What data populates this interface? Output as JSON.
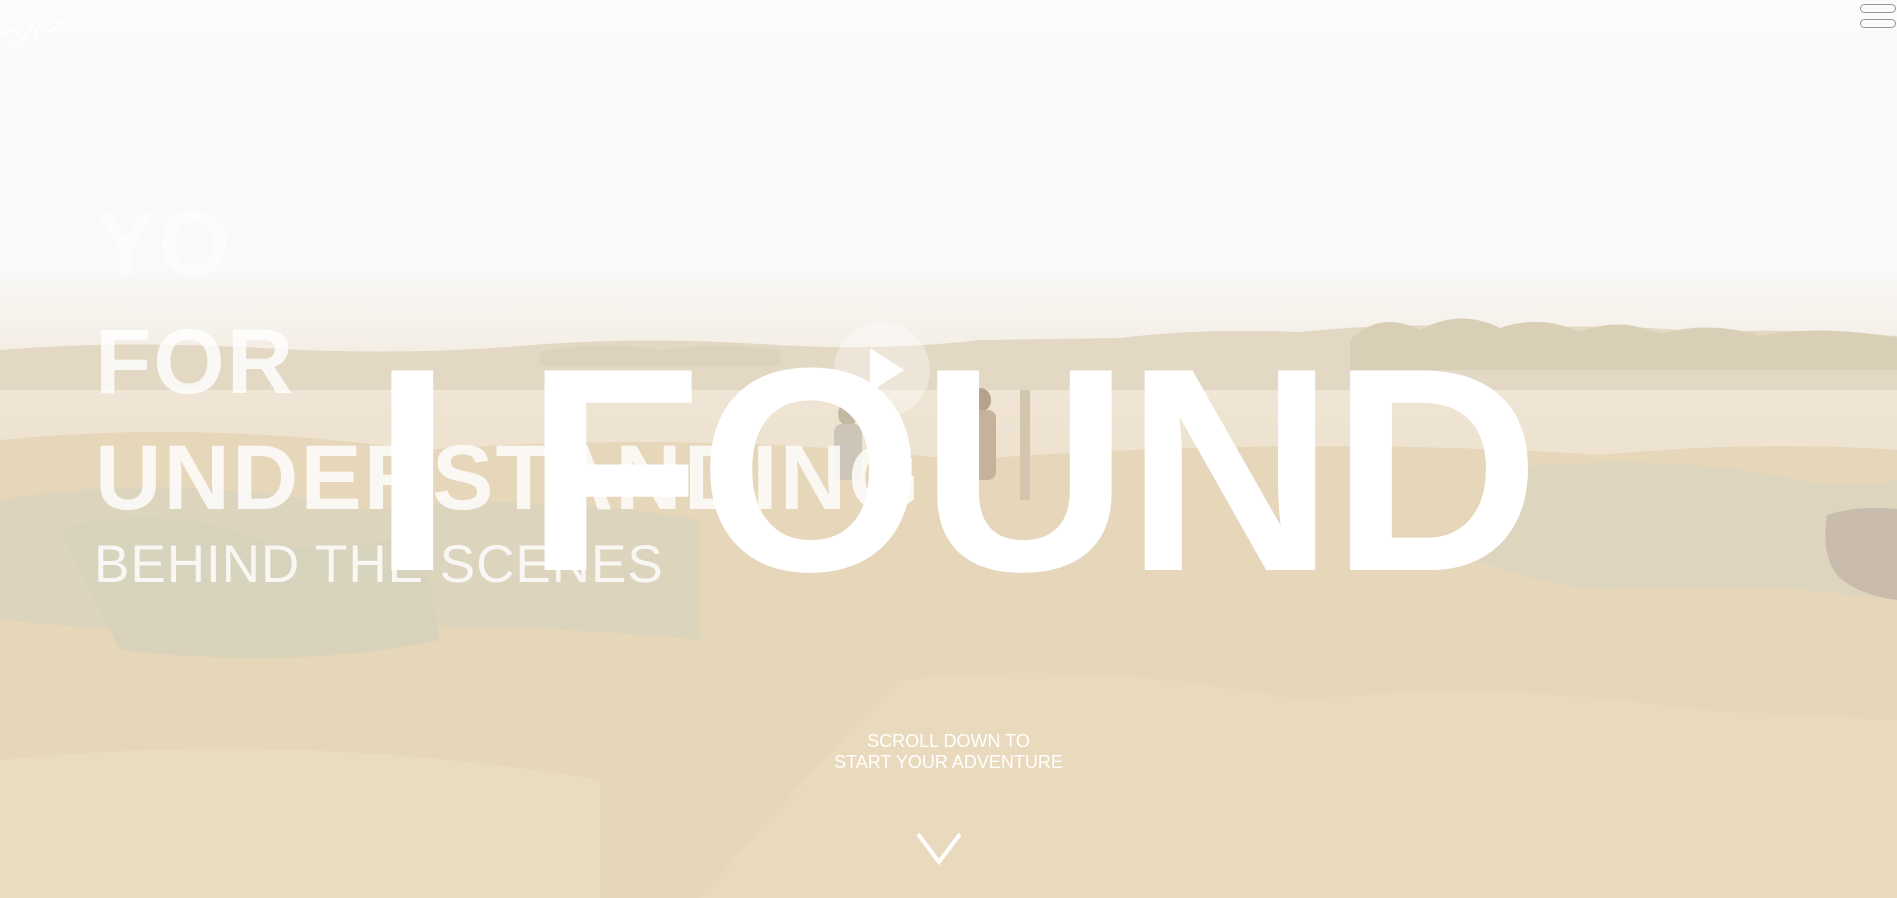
{
  "header": {
    "logo_icon": "signature-logo-icon",
    "menu_icon": "hamburger-menu-icon"
  },
  "background_text": {
    "line1": "YO",
    "line2": "FOR",
    "line3": "UNDERSTANDING",
    "line4": "BEHIND THE SCENES"
  },
  "hero": {
    "title": "I FOUND",
    "play_icon": "play-icon"
  },
  "scroll_prompt": {
    "line1": "SCROLL DOWN TO",
    "line2": "START YOUR ADVENTURE",
    "icon": "chevron-down-icon"
  },
  "colors": {
    "text": "#ffffff",
    "background": "#ece0cb"
  }
}
